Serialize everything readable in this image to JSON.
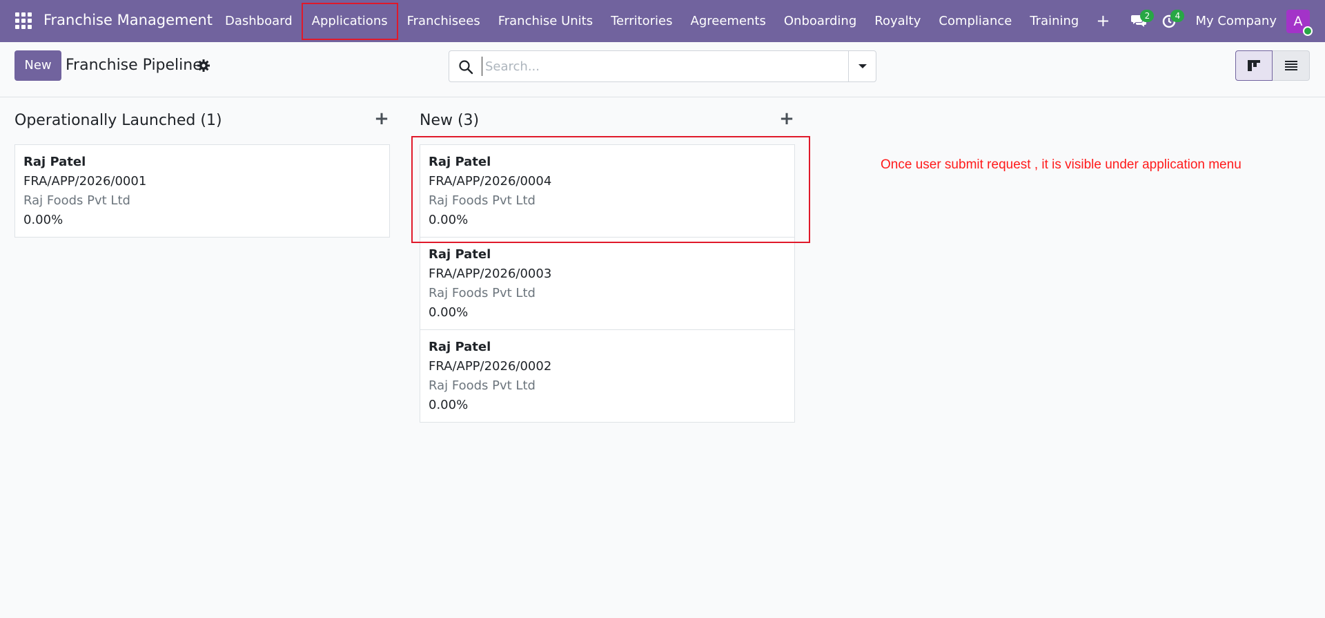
{
  "navbar": {
    "brand": "Franchise Management",
    "menu": [
      "Dashboard",
      "Applications",
      "Franchisees",
      "Franchise Units",
      "Territories",
      "Agreements",
      "Onboarding",
      "Royalty",
      "Compliance",
      "Training"
    ],
    "plus_label": "+",
    "messages_count": "2",
    "activities_count": "4",
    "company": "My Company",
    "avatar_letter": "A"
  },
  "control": {
    "new_label": "New",
    "title": "Franchise Pipeline",
    "search_placeholder": "Search..."
  },
  "columns": [
    {
      "title": "Operationally Launched (1)",
      "cards": [
        {
          "name": "Raj Patel",
          "ref": "FRA/APP/2026/0001",
          "company": "Raj Foods Pvt Ltd",
          "pct": "0.00%"
        }
      ]
    },
    {
      "title": "New (3)",
      "cards": [
        {
          "name": "Raj Patel",
          "ref": "FRA/APP/2026/0004",
          "company": "Raj Foods Pvt Ltd",
          "pct": "0.00%"
        },
        {
          "name": "Raj Patel",
          "ref": "FRA/APP/2026/0003",
          "company": "Raj Foods Pvt Ltd",
          "pct": "0.00%"
        },
        {
          "name": "Raj Patel",
          "ref": "FRA/APP/2026/0002",
          "company": "Raj Foods Pvt Ltd",
          "pct": "0.00%"
        }
      ]
    }
  ],
  "annotation": "Once user submit request , it is visible under application menu",
  "colors": {
    "navbar": "#71639e",
    "highlight": "#e0192a",
    "badge": "#28a745",
    "avatar": "#a333c8"
  },
  "icons": [
    "apps-grid-icon",
    "chat-icon",
    "activity-clock-icon",
    "gear-icon",
    "search-icon",
    "caret-down-icon",
    "kanban-view-icon",
    "list-view-icon",
    "plus-icon"
  ]
}
